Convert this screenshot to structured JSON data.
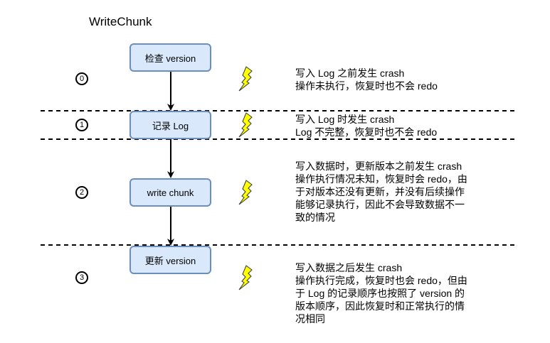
{
  "title": "WriteChunk",
  "steps": [
    {
      "index": "0",
      "label": "检查 version",
      "note": [
        "写入 Log 之前发生 crash",
        "操作未执行，恢复时也不会 redo"
      ]
    },
    {
      "index": "1",
      "label": "记录 Log",
      "note": [
        "写入 Log 时发生 crash",
        "Log 不完整，恢复时也不会 redo"
      ]
    },
    {
      "index": "2",
      "label": "write chunk",
      "note": [
        "写入数据时，更新版本之前发生 crash",
        "操作执行情况未知，恢复时会 redo，由",
        "于对版本还没有更新，并没有后续操作",
        "能够记录执行，因此不会导致数据不一",
        "致的情况"
      ]
    },
    {
      "index": "3",
      "label": "更新 version",
      "note": [
        "写入数据之后发生 crash",
        "操作执行完成，恢复时也会 redo，但由",
        "于 Log 的记录顺序也按照了 version 的",
        "版本顺序，因此恢复时和正常执行的情",
        "况相同"
      ]
    }
  ],
  "colors": {
    "box_fill": "#dae8fc",
    "box_stroke": "#6c8ebf",
    "bolt": "#ffff00"
  }
}
